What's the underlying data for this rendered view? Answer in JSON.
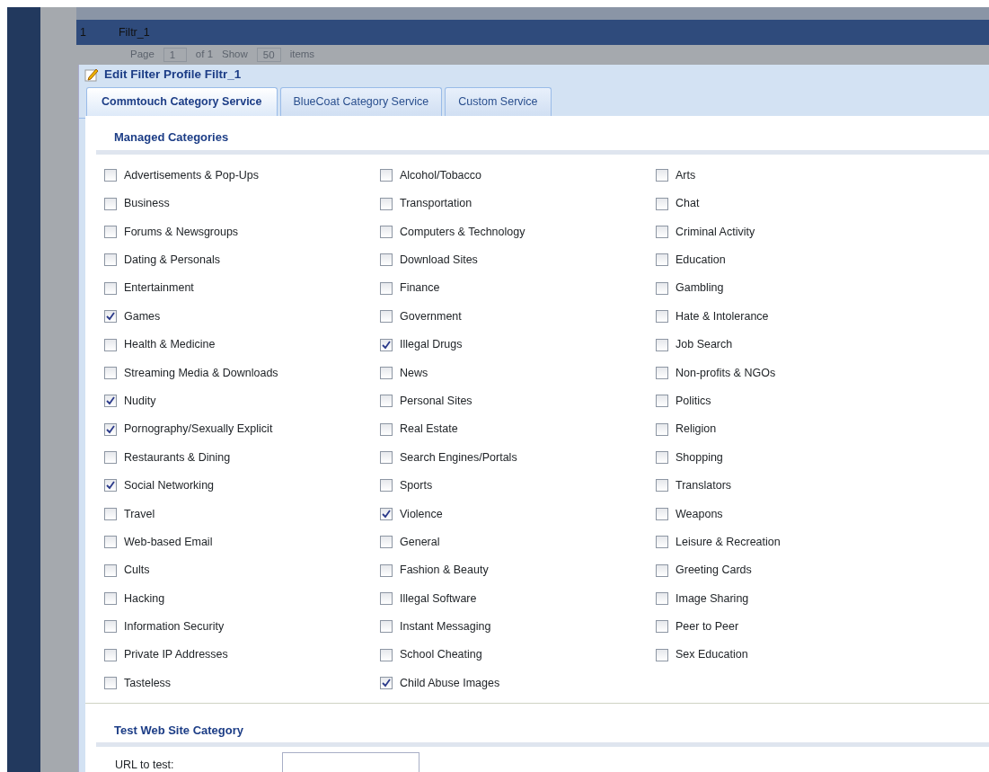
{
  "background_list": {
    "row": {
      "number": "1",
      "name": "Filtr_1",
      "selected": true
    },
    "pager": {
      "page_label": "Page",
      "page_value": "1",
      "of_label": "of 1",
      "show_label": "Show",
      "show_value": "50",
      "items_label": "items"
    }
  },
  "dialog": {
    "title": "Edit Filter Profile Filtr_1",
    "tabs": [
      {
        "label": "Commtouch Category Service",
        "selected": true
      },
      {
        "label": "BlueCoat Category Service",
        "selected": false
      },
      {
        "label": "Custom Service",
        "selected": false
      }
    ],
    "managed_categories": {
      "heading": "Managed Categories",
      "items": [
        {
          "label": "Advertisements & Pop-Ups",
          "checked": false
        },
        {
          "label": "Alcohol/Tobacco",
          "checked": false
        },
        {
          "label": "Arts",
          "checked": false
        },
        {
          "label": "Business",
          "checked": false
        },
        {
          "label": "Transportation",
          "checked": false
        },
        {
          "label": "Chat",
          "checked": false
        },
        {
          "label": "Forums & Newsgroups",
          "checked": false
        },
        {
          "label": "Computers & Technology",
          "checked": false
        },
        {
          "label": "Criminal Activity",
          "checked": false
        },
        {
          "label": "Dating & Personals",
          "checked": false
        },
        {
          "label": "Download Sites",
          "checked": false
        },
        {
          "label": "Education",
          "checked": false
        },
        {
          "label": "Entertainment",
          "checked": false
        },
        {
          "label": "Finance",
          "checked": false
        },
        {
          "label": "Gambling",
          "checked": false
        },
        {
          "label": "Games",
          "checked": true
        },
        {
          "label": "Government",
          "checked": false
        },
        {
          "label": "Hate & Intolerance",
          "checked": false
        },
        {
          "label": "Health & Medicine",
          "checked": false
        },
        {
          "label": "Illegal Drugs",
          "checked": true
        },
        {
          "label": "Job Search",
          "checked": false
        },
        {
          "label": "Streaming Media & Downloads",
          "checked": false
        },
        {
          "label": "News",
          "checked": false
        },
        {
          "label": "Non-profits & NGOs",
          "checked": false
        },
        {
          "label": "Nudity",
          "checked": true
        },
        {
          "label": "Personal Sites",
          "checked": false
        },
        {
          "label": "Politics",
          "checked": false
        },
        {
          "label": "Pornography/Sexually Explicit",
          "checked": true
        },
        {
          "label": "Real Estate",
          "checked": false
        },
        {
          "label": "Religion",
          "checked": false
        },
        {
          "label": "Restaurants & Dining",
          "checked": false
        },
        {
          "label": "Search Engines/Portals",
          "checked": false
        },
        {
          "label": "Shopping",
          "checked": false
        },
        {
          "label": "Social Networking",
          "checked": true
        },
        {
          "label": "Sports",
          "checked": false
        },
        {
          "label": "Translators",
          "checked": false
        },
        {
          "label": "Travel",
          "checked": false
        },
        {
          "label": "Violence",
          "checked": true
        },
        {
          "label": "Weapons",
          "checked": false
        },
        {
          "label": "Web-based Email",
          "checked": false
        },
        {
          "label": "General",
          "checked": false
        },
        {
          "label": "Leisure & Recreation",
          "checked": false
        },
        {
          "label": "Cults",
          "checked": false
        },
        {
          "label": "Fashion & Beauty",
          "checked": false
        },
        {
          "label": "Greeting Cards",
          "checked": false
        },
        {
          "label": "Hacking",
          "checked": false
        },
        {
          "label": "Illegal Software",
          "checked": false
        },
        {
          "label": "Image Sharing",
          "checked": false
        },
        {
          "label": "Information Security",
          "checked": false
        },
        {
          "label": "Instant Messaging",
          "checked": false
        },
        {
          "label": "Peer to Peer",
          "checked": false
        },
        {
          "label": "Private IP Addresses",
          "checked": false
        },
        {
          "label": "School Cheating",
          "checked": false
        },
        {
          "label": "Sex Education",
          "checked": false
        },
        {
          "label": "Tasteless",
          "checked": false
        },
        {
          "label": "Child Abuse Images",
          "checked": true
        }
      ]
    },
    "test_section": {
      "heading": "Test Web Site Category",
      "url_label": "URL to test:"
    }
  }
}
